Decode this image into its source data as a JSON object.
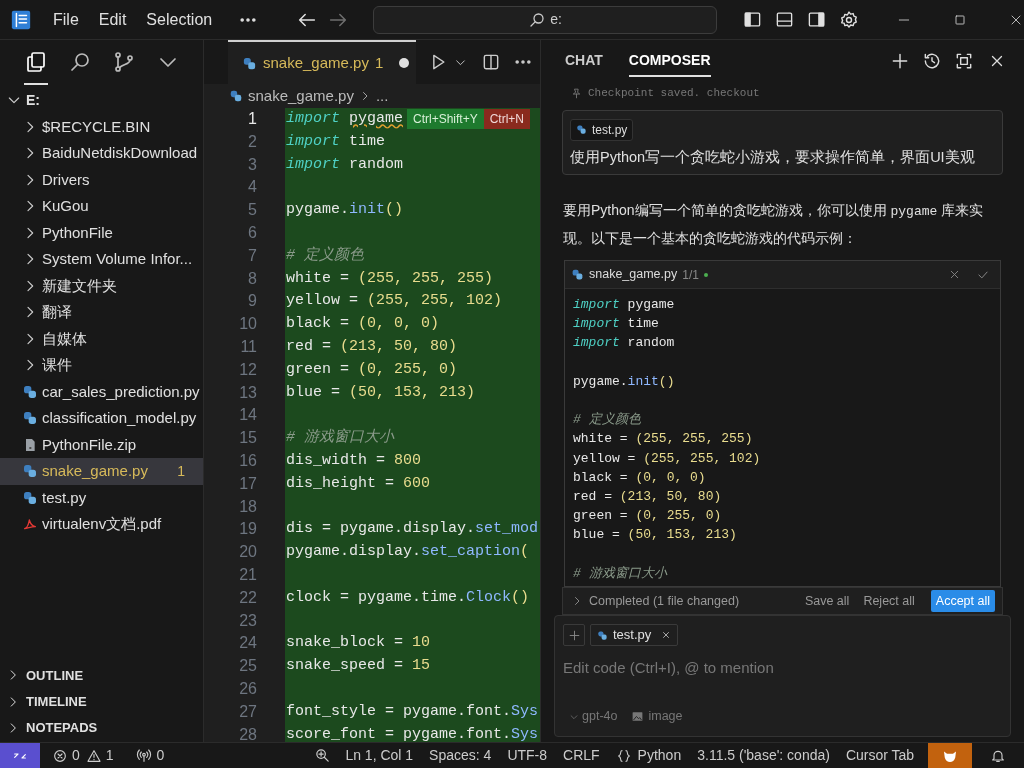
{
  "title_bar": {
    "menus": [
      "File",
      "Edit",
      "Selection"
    ],
    "navigation": [
      {
        "kind": "back",
        "disabled": false
      },
      {
        "kind": "forward",
        "disabled": true
      }
    ],
    "search": {
      "value": "e:"
    }
  },
  "activity_bar": [
    {
      "kind": "files",
      "selected": true
    },
    {
      "kind": "search",
      "selected": false
    },
    {
      "kind": "source-control",
      "selected": false
    },
    {
      "kind": "more",
      "selected": false
    }
  ],
  "explorer": {
    "tree": [
      {
        "label": "E:",
        "kind": "folder",
        "expanded": true,
        "selected": false,
        "children": [
          {
            "label": "$RECYCLE.BIN",
            "kind": "folder",
            "expanded": false,
            "selected": false
          },
          {
            "label": "BaiduNetdiskDownload",
            "kind": "folder",
            "expanded": false,
            "selected": false
          },
          {
            "label": "Drivers",
            "kind": "folder",
            "expanded": false,
            "selected": false
          },
          {
            "label": "KuGou",
            "kind": "folder",
            "expanded": false,
            "selected": false
          },
          {
            "label": "PythonFile",
            "kind": "folder",
            "expanded": false,
            "selected": false
          },
          {
            "label": "System Volume Infor...",
            "kind": "folder",
            "expanded": false,
            "selected": false
          },
          {
            "label": "新建文件夹",
            "kind": "folder",
            "expanded": false,
            "selected": false
          },
          {
            "label": "翻译",
            "kind": "folder",
            "expanded": false,
            "selected": false
          },
          {
            "label": "自媒体",
            "kind": "folder",
            "expanded": false,
            "selected": false
          },
          {
            "label": "课件",
            "kind": "folder",
            "expanded": false,
            "selected": false
          },
          {
            "label": "car_sales_prediction.py",
            "kind": "python",
            "selected": false
          },
          {
            "label": "classification_model.py",
            "kind": "python",
            "selected": false
          },
          {
            "label": "PythonFile.zip",
            "kind": "zip",
            "selected": false
          },
          {
            "label": "snake_game.py",
            "kind": "python",
            "selected": true,
            "badge": "1"
          },
          {
            "label": "test.py",
            "kind": "python",
            "selected": false
          },
          {
            "label": "virtualenv文档.pdf",
            "kind": "pdf",
            "selected": false
          }
        ]
      }
    ],
    "sections": [
      {
        "label": "OUTLINE",
        "expanded": false
      },
      {
        "label": "TIMELINE",
        "expanded": false
      },
      {
        "label": "NOTEPADS",
        "expanded": false
      }
    ]
  },
  "editor": {
    "tab": {
      "label": "snake_game.py",
      "badge": "1",
      "modified": true
    },
    "breadcrumb": [
      "snake_game.py",
      "..."
    ],
    "hints": [
      {
        "label": "Ctrl+Shift+Y",
        "kind": "accept"
      },
      {
        "label": "Ctrl+N",
        "kind": "reject"
      }
    ],
    "lines": [
      {
        "number": "1",
        "current": true,
        "segments": [
          {
            "kind": "keyword",
            "text": "import "
          },
          {
            "kind": "warning",
            "text": "pygame"
          }
        ]
      },
      {
        "number": "2",
        "current": false,
        "segments": [
          {
            "kind": "keyword",
            "text": "import "
          },
          {
            "kind": "name",
            "text": "time"
          }
        ]
      },
      {
        "number": "3",
        "current": false,
        "segments": [
          {
            "kind": "keyword",
            "text": "import "
          },
          {
            "kind": "name",
            "text": "random"
          }
        ]
      },
      {
        "number": "4",
        "current": false
      },
      {
        "number": "5",
        "current": false,
        "segments": [
          {
            "kind": "name",
            "text": "pygame."
          },
          {
            "kind": "function",
            "text": "init"
          },
          {
            "kind": "literal",
            "text": "()"
          }
        ]
      },
      {
        "number": "6",
        "current": false
      },
      {
        "number": "7",
        "current": false,
        "segments": [
          {
            "kind": "comment",
            "text": "# 定义颜色"
          }
        ]
      },
      {
        "number": "8",
        "current": false,
        "segments": [
          {
            "kind": "name",
            "text": "white = "
          },
          {
            "kind": "literal",
            "text": "(255, 255, 255)"
          }
        ]
      },
      {
        "number": "9",
        "current": false,
        "segments": [
          {
            "kind": "name",
            "text": "yellow = "
          },
          {
            "kind": "literal",
            "text": "(255, 255, 102)"
          }
        ]
      },
      {
        "number": "10",
        "current": false,
        "segments": [
          {
            "kind": "name",
            "text": "black = "
          },
          {
            "kind": "literal",
            "text": "(0, 0, 0)"
          }
        ]
      },
      {
        "number": "11",
        "current": false,
        "segments": [
          {
            "kind": "name",
            "text": "red = "
          },
          {
            "kind": "literal",
            "text": "(213, 50, 80)"
          }
        ]
      },
      {
        "number": "12",
        "current": false,
        "segments": [
          {
            "kind": "name",
            "text": "green = "
          },
          {
            "kind": "literal",
            "text": "(0, 255, 0)"
          }
        ]
      },
      {
        "number": "13",
        "current": false,
        "segments": [
          {
            "kind": "name",
            "text": "blue = "
          },
          {
            "kind": "literal",
            "text": "(50, 153, 213)"
          }
        ]
      },
      {
        "number": "14",
        "current": false
      },
      {
        "number": "15",
        "current": false,
        "segments": [
          {
            "kind": "comment",
            "text": "# 游戏窗口大小"
          }
        ]
      },
      {
        "number": "16",
        "current": false,
        "segments": [
          {
            "kind": "name",
            "text": "dis_width = "
          },
          {
            "kind": "literal",
            "text": "800"
          }
        ]
      },
      {
        "number": "17",
        "current": false,
        "segments": [
          {
            "kind": "name",
            "text": "dis_height = "
          },
          {
            "kind": "literal",
            "text": "600"
          }
        ]
      },
      {
        "number": "18",
        "current": false
      },
      {
        "number": "19",
        "current": false,
        "segments": [
          {
            "kind": "name",
            "text": "dis = pygame.display."
          },
          {
            "kind": "function",
            "text": "set_mod"
          }
        ]
      },
      {
        "number": "20",
        "current": false,
        "segments": [
          {
            "kind": "name",
            "text": "pygame.display."
          },
          {
            "kind": "function",
            "text": "set_caption"
          },
          {
            "kind": "literal",
            "text": "("
          }
        ]
      },
      {
        "number": "21",
        "current": false
      },
      {
        "number": "22",
        "current": false,
        "segments": [
          {
            "kind": "name",
            "text": "clock = pygame.time."
          },
          {
            "kind": "function",
            "text": "Clock"
          },
          {
            "kind": "literal",
            "text": "()"
          }
        ]
      },
      {
        "number": "23",
        "current": false
      },
      {
        "number": "24",
        "current": false,
        "segments": [
          {
            "kind": "name",
            "text": "snake_block = "
          },
          {
            "kind": "literal",
            "text": "10"
          }
        ]
      },
      {
        "number": "25",
        "current": false,
        "segments": [
          {
            "kind": "name",
            "text": "snake_speed = "
          },
          {
            "kind": "literal",
            "text": "15"
          }
        ]
      },
      {
        "number": "26",
        "current": false
      },
      {
        "number": "27",
        "current": false,
        "segments": [
          {
            "kind": "name",
            "text": "font_style = pygame.font."
          },
          {
            "kind": "function",
            "text": "Sys"
          }
        ]
      },
      {
        "number": "28",
        "current": false,
        "segments": [
          {
            "kind": "name",
            "text": "score_font = pygame.font."
          },
          {
            "kind": "function",
            "text": "Sys"
          }
        ]
      }
    ]
  },
  "chat": {
    "tabs": [
      {
        "label": "CHAT",
        "selected": false
      },
      {
        "label": "COMPOSER",
        "selected": true
      }
    ],
    "checkpoint": "Checkpoint saved. checkout",
    "user_message": {
      "file": "test.py",
      "text": "使用Python写一个贪吃蛇小游戏，要求操作简单，界面UI美观"
    },
    "reply": [
      {
        "text": "要用Python编写一个简单的贪吃蛇游戏，你可以使用 ",
        "code": false
      },
      {
        "text": "pygame",
        "code": true
      },
      {
        "text": " 库来实现。以下是一个基本的贪吃蛇游戏的代码示例：",
        "code": false
      }
    ],
    "code_block": {
      "file": "snake_game.py",
      "count": "1/1",
      "lines": [
        {
          "kind": "code",
          "segments": [
            {
              "kind": "keyword",
              "text": "import "
            },
            {
              "kind": "name",
              "text": "pygame"
            }
          ]
        },
        {
          "kind": "code",
          "segments": [
            {
              "kind": "keyword",
              "text": "import "
            },
            {
              "kind": "name",
              "text": "time"
            }
          ]
        },
        {
          "kind": "code",
          "segments": [
            {
              "kind": "keyword",
              "text": "import "
            },
            {
              "kind": "name",
              "text": "random"
            }
          ]
        },
        {
          "kind": "blank"
        },
        {
          "kind": "code",
          "segments": [
            {
              "kind": "name",
              "text": "pygame."
            },
            {
              "kind": "function",
              "text": "init"
            },
            {
              "kind": "literal",
              "text": "()"
            }
          ]
        },
        {
          "kind": "blank"
        },
        {
          "kind": "code",
          "segments": [
            {
              "kind": "comment",
              "text": "# 定义颜色"
            }
          ]
        },
        {
          "kind": "code",
          "segments": [
            {
              "kind": "name",
              "text": "white = "
            },
            {
              "kind": "literal",
              "text": "(255, 255, 255)"
            }
          ]
        },
        {
          "kind": "code",
          "segments": [
            {
              "kind": "name",
              "text": "yellow = "
            },
            {
              "kind": "literal",
              "text": "(255, 255, 102)"
            }
          ]
        },
        {
          "kind": "code",
          "segments": [
            {
              "kind": "name",
              "text": "black = "
            },
            {
              "kind": "literal",
              "text": "(0, 0, 0)"
            }
          ]
        },
        {
          "kind": "code",
          "segments": [
            {
              "kind": "name",
              "text": "red = "
            },
            {
              "kind": "literal",
              "text": "(213, 50, 80)"
            }
          ]
        },
        {
          "kind": "code",
          "segments": [
            {
              "kind": "name",
              "text": "green = "
            },
            {
              "kind": "literal",
              "text": "(0, 255, 0)"
            }
          ]
        },
        {
          "kind": "code",
          "segments": [
            {
              "kind": "name",
              "text": "blue = "
            },
            {
              "kind": "literal",
              "text": "(50, 153, 213)"
            }
          ]
        },
        {
          "kind": "blank"
        },
        {
          "kind": "code",
          "segments": [
            {
              "kind": "comment",
              "text": "# 游戏窗口大小"
            }
          ]
        }
      ]
    },
    "completed": {
      "label": "Completed (1 file changed)",
      "actions": [
        {
          "label": "Save all",
          "kind": "secondary"
        },
        {
          "label": "Reject all",
          "kind": "secondary"
        },
        {
          "label": "Accept all",
          "kind": "primary"
        }
      ]
    },
    "composer": {
      "file": "test.py",
      "placeholder": "Edit code (Ctrl+I), @ to mention",
      "model": "gpt-4o",
      "attachment": "image"
    }
  },
  "status_bar": {
    "errors": "0",
    "warnings": "1",
    "ports": "0",
    "items": [
      "Ln 1, Col 1",
      "Spaces: 4",
      "UTF-8",
      "CRLF"
    ],
    "language": "Python",
    "interpreter": "3.11.5 ('base': conda)",
    "cursor_tab": "Cursor Tab"
  }
}
